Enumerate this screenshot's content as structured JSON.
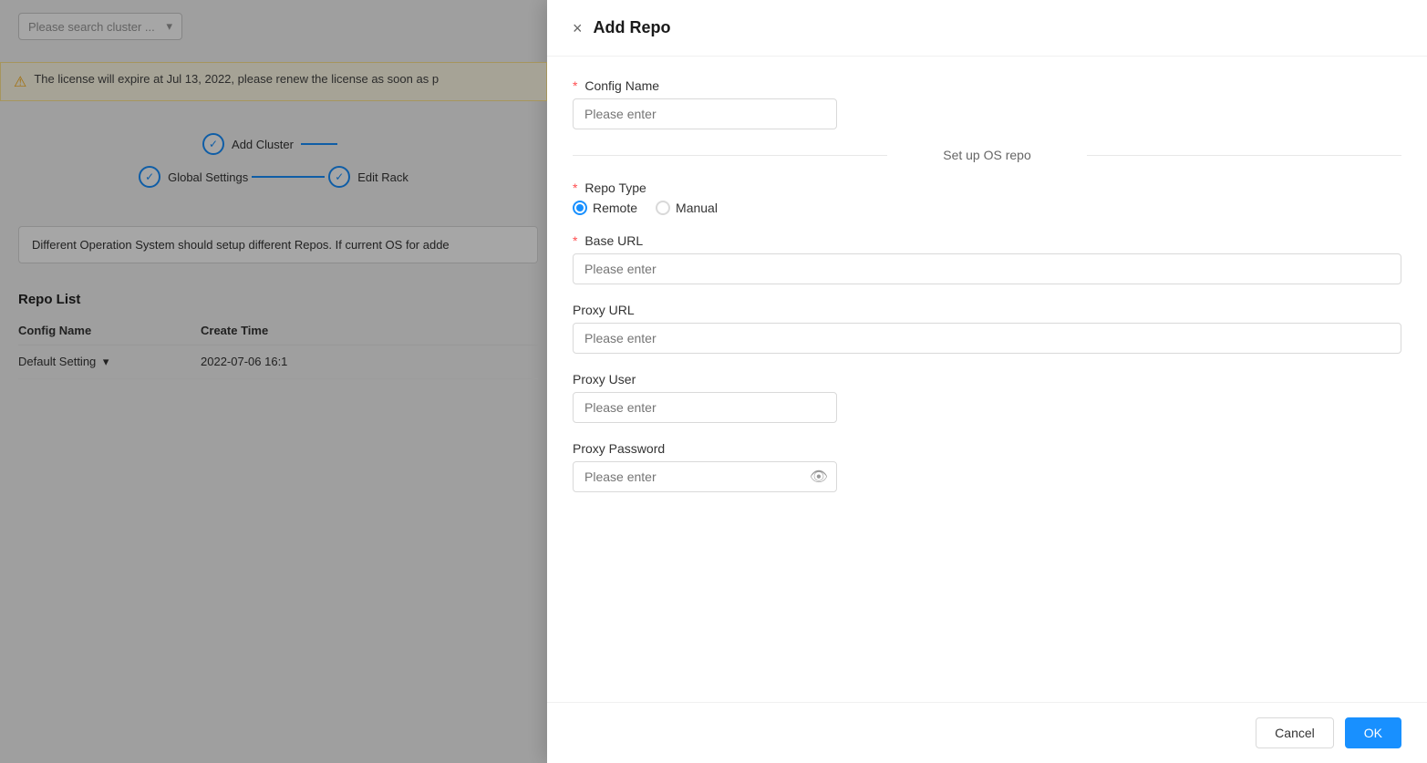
{
  "background": {
    "search_placeholder": "Please search cluster ...",
    "license_warning": "The license will expire at Jul 13, 2022, please renew the license as soon as p",
    "steps": [
      {
        "label": "Add Cluster",
        "done": true
      },
      {
        "label": "Global Settings",
        "done": true
      },
      {
        "label": "Edit Rack",
        "done": true
      },
      {
        "label": "Set up OS repo",
        "done": false
      }
    ],
    "description": "Different Operation System should setup different Repos. If current OS for adde",
    "repo_list_title": "Repo List",
    "table_headers": [
      "Config Name",
      "Create Time"
    ],
    "table_rows": [
      {
        "config_name": "Default Setting",
        "create_time": "2022-07-06 16:1"
      }
    ]
  },
  "modal": {
    "title": "Add Repo",
    "close_icon": "×",
    "section_label": "Set up OS repo",
    "fields": {
      "config_name": {
        "label": "Config Name",
        "required": true,
        "placeholder": "Please enter"
      },
      "repo_type": {
        "label": "Repo Type",
        "required": true,
        "options": [
          {
            "value": "remote",
            "label": "Remote",
            "selected": true
          },
          {
            "value": "manual",
            "label": "Manual",
            "selected": false
          }
        ]
      },
      "base_url": {
        "label": "Base URL",
        "required": true,
        "placeholder": "Please enter"
      },
      "proxy_url": {
        "label": "Proxy URL",
        "required": false,
        "placeholder": "Please enter"
      },
      "proxy_user": {
        "label": "Proxy User",
        "required": false,
        "placeholder": "Please enter"
      },
      "proxy_password": {
        "label": "Proxy Password",
        "required": false,
        "placeholder": "Please enter"
      }
    },
    "footer": {
      "cancel_label": "Cancel",
      "ok_label": "OK"
    }
  }
}
